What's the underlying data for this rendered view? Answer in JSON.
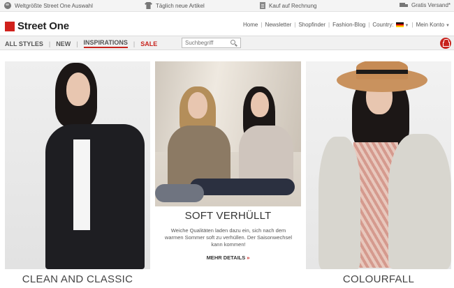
{
  "infobar": {
    "items": [
      {
        "icon": "globe-icon",
        "label": "Weltgrößte Street One Auswahl"
      },
      {
        "icon": "shirt-icon",
        "label": "Täglich neue Artikel"
      },
      {
        "icon": "invoice-icon",
        "label": "Kauf auf Rechnung"
      },
      {
        "icon": "truck-icon",
        "label": "Gratis Versand*"
      }
    ]
  },
  "header": {
    "logo_text": "Street One",
    "nav": {
      "home": "Home",
      "newsletter": "Newsletter",
      "shopfinder": "Shopfinder",
      "blog": "Fashion-Blog",
      "country_label": "Country:",
      "account": "Mein Konto"
    }
  },
  "categories": {
    "all_styles": "ALL STYLES",
    "new": "NEW",
    "inspirations": "INSPIRATIONS",
    "sale": "SALE"
  },
  "search": {
    "placeholder": "Suchbegriff"
  },
  "tiles": {
    "left_caption": "CLEAN AND CLASSIC",
    "middle": {
      "title": "SOFT VERHÜLLT",
      "text": "Weiche Qualitäten laden dazu ein, sich nach dem warmen Sommer soft zu verhüllen. Der Saisonwechsel kann kommen!",
      "link": "MEHR DETAILS",
      "link_arrows": "»"
    },
    "right_caption": "COLOURFALL"
  },
  "colors": {
    "brand": "#d0211c",
    "accent": "#c8241e"
  }
}
